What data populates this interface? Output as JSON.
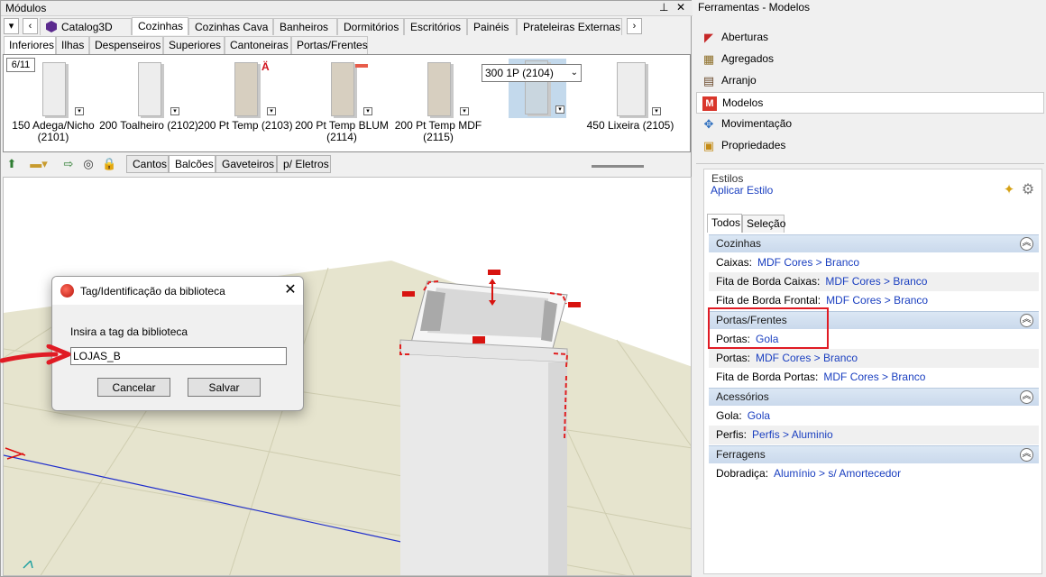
{
  "left_panel": {
    "title": "Módulos",
    "pin_glyph": "⊥",
    "close_glyph": "✕",
    "catalog_tabs": [
      "Catalog3D",
      "Cozinhas",
      "Cozinhas Cava",
      "Banheiros",
      "Dormitórios",
      "Escritórios",
      "Painéis",
      "Prateleiras Externas"
    ],
    "active_catalog_tab": "Cozinhas",
    "sub_tabs": [
      "Inferiores",
      "Ilhas",
      "Despenseiros",
      "Superiores",
      "Cantoneiras",
      "Portas/Frentes"
    ],
    "active_sub_tab": "Inferiores",
    "gallery": {
      "page_indicator": "6/11",
      "items": [
        {
          "name": "150 Adega/Nicho",
          "code": "(2101)"
        },
        {
          "name": "200 Toalheiro (2102)",
          "code": ""
        },
        {
          "name": "200 Pt Temp (2103)",
          "code": ""
        },
        {
          "name": "200 Pt Temp BLUM",
          "code": "(2114)"
        },
        {
          "name": "200 Pt Temp MDF",
          "code": "(2115)"
        },
        {
          "name": "",
          "code": ""
        },
        {
          "name": "450 Lixeira (2105)",
          "code": ""
        }
      ],
      "selected_value": "300 1P (2104)"
    },
    "view_tabs": [
      "Cantos",
      "Balcões",
      "Gaveteiros",
      "p/ Eletros"
    ],
    "active_view_tab": "Balcões"
  },
  "dialog": {
    "title": "Tag/Identificação da biblioteca",
    "label": "Insira a tag da biblioteca",
    "input_value": "LOJAS_B",
    "cancel_label": "Cancelar",
    "save_label": "Salvar"
  },
  "right_panel": {
    "title": "Ferramentas - Modelos",
    "tools": [
      "Aberturas",
      "Agregados",
      "Arranjo",
      "Modelos",
      "Movimentação",
      "Propriedades"
    ],
    "active_tool": "Modelos",
    "styles_label": "Estilos",
    "apply_style": "Aplicar Estilo",
    "tabs": [
      "Todos",
      "Seleção"
    ],
    "active_tab": "Todos",
    "sections": [
      {
        "title": "Cozinhas",
        "rows": [
          {
            "label": "Caixas:",
            "value": "MDF Cores > Branco"
          },
          {
            "label": "Fita de Borda Caixas:",
            "value": "MDF Cores > Branco"
          },
          {
            "label": "Fita de Borda Frontal:",
            "value": "MDF Cores > Branco"
          }
        ]
      },
      {
        "title": "Portas/Frentes",
        "rows": [
          {
            "label": "Portas:",
            "value": "Gola"
          },
          {
            "label": "Portas:",
            "value": "MDF Cores > Branco"
          },
          {
            "label": "Fita de Borda Portas:",
            "value": "MDF Cores > Branco"
          }
        ]
      },
      {
        "title": "Acessórios",
        "rows": [
          {
            "label": "Gola:",
            "value": "Gola"
          },
          {
            "label": "Perfis:",
            "value": "Perfis > Aluminio"
          }
        ]
      },
      {
        "title": "Ferragens",
        "rows": [
          {
            "label": "Dobradiça:",
            "value": "Alumínio > s/ Amortecedor"
          }
        ]
      }
    ]
  },
  "colors": {
    "link_blue": "#1a3fc0",
    "highlight_red": "#e01b24",
    "section_header": "#cad9ec",
    "grid_floor": "#e6e4ce"
  },
  "icons": {
    "tool_icons": [
      "aberturas-icon",
      "agregados-icon",
      "arranjo-icon",
      "modelos-icon",
      "movimentacao-icon",
      "propriedades-icon"
    ]
  }
}
